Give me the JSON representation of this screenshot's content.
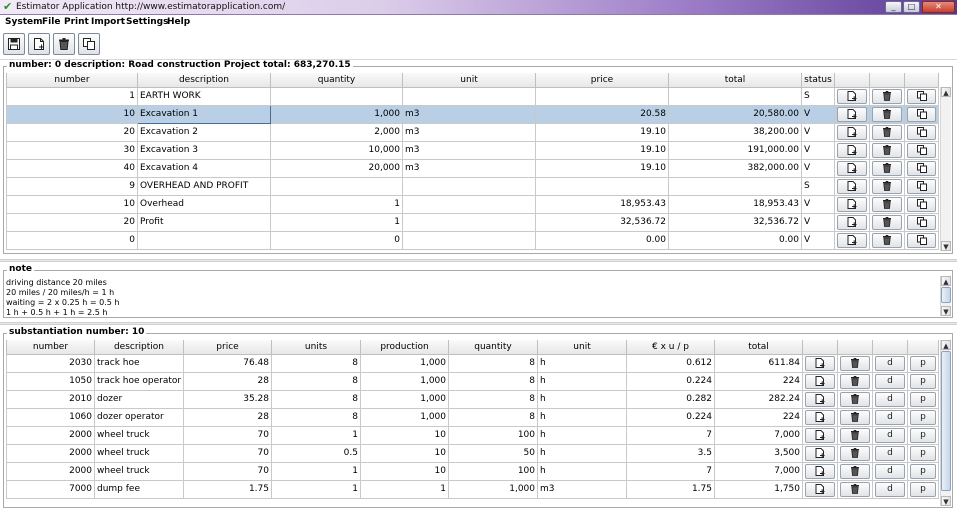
{
  "window": {
    "title": "Estimator Application http://www.estimatorapplication.com/",
    "minimize": "_",
    "maximize": "□",
    "close": "✕"
  },
  "menu": [
    "System",
    "File",
    "Print",
    "Import",
    "Settings",
    "Help"
  ],
  "toolbar": {
    "save_icon": "floppy-disk",
    "new_icon": "new-document",
    "delete_icon": "trash",
    "copy_icon": "copy-documents"
  },
  "project": {
    "title": "number: 0 description: Road construction Project total: 683,270.15",
    "columns": [
      "number",
      "description",
      "quantity",
      "unit",
      "price",
      "total",
      "status",
      "",
      "",
      ""
    ],
    "rows": [
      {
        "number": "1",
        "description": "EARTH WORK",
        "quantity": "",
        "unit": "",
        "price": "",
        "total": "",
        "status": "S"
      },
      {
        "number": "10",
        "description": "Excavation 1",
        "quantity": "1,000",
        "unit": "m3",
        "price": "20.58",
        "total": "20,580.00",
        "status": "V"
      },
      {
        "number": "20",
        "description": "Excavation 2",
        "quantity": "2,000",
        "unit": "m3",
        "price": "19.10",
        "total": "38,200.00",
        "status": "V"
      },
      {
        "number": "30",
        "description": "Excavation 3",
        "quantity": "10,000",
        "unit": "m3",
        "price": "19.10",
        "total": "191,000.00",
        "status": "V"
      },
      {
        "number": "40",
        "description": "Excavation 4",
        "quantity": "20,000",
        "unit": "m3",
        "price": "19.10",
        "total": "382,000.00",
        "status": "V"
      },
      {
        "number": "9",
        "description": "OVERHEAD AND PROFIT",
        "quantity": "",
        "unit": "",
        "price": "",
        "total": "",
        "status": "S"
      },
      {
        "number": "10",
        "description": "Overhead",
        "quantity": "1",
        "unit": "",
        "price": "18,953.43",
        "total": "18,953.43",
        "status": "V"
      },
      {
        "number": "20",
        "description": "Profit",
        "quantity": "1",
        "unit": "",
        "price": "32,536.72",
        "total": "32,536.72",
        "status": "V"
      },
      {
        "number": "0",
        "description": "",
        "quantity": "0",
        "unit": "",
        "price": "0.00",
        "total": "0.00",
        "status": "V"
      }
    ]
  },
  "note": {
    "title": "note",
    "text": "driving distance 20 miles\n20 miles / 20 miles/h = 1 h\nwaiting = 2 x 0.25 h = 0.5 h\n1 h + 0.5 h + 1 h = 2.5 h"
  },
  "substantiation": {
    "title": "substantiation number: 10",
    "columns": [
      "number",
      "description",
      "price",
      "units",
      "production",
      "quantity",
      "unit",
      "€ x u / p",
      "total",
      "",
      "",
      "",
      ""
    ],
    "rows": [
      {
        "number": "2030",
        "description": "track hoe",
        "price": "76.48",
        "units": "8",
        "production": "1,000",
        "quantity": "8",
        "unit": "h",
        "eup": "0.612",
        "total": "611.84"
      },
      {
        "number": "1050",
        "description": "track hoe operator",
        "price": "28",
        "units": "8",
        "production": "1,000",
        "quantity": "8",
        "unit": "h",
        "eup": "0.224",
        "total": "224"
      },
      {
        "number": "2010",
        "description": "dozer",
        "price": "35.28",
        "units": "8",
        "production": "1,000",
        "quantity": "8",
        "unit": "h",
        "eup": "0.282",
        "total": "282.24"
      },
      {
        "number": "1060",
        "description": "dozer operator",
        "price": "28",
        "units": "8",
        "production": "1,000",
        "quantity": "8",
        "unit": "h",
        "eup": "0.224",
        "total": "224"
      },
      {
        "number": "2000",
        "description": "wheel truck",
        "price": "70",
        "units": "1",
        "production": "10",
        "quantity": "100",
        "unit": "h",
        "eup": "7",
        "total": "7,000"
      },
      {
        "number": "2000",
        "description": "wheel truck",
        "price": "70",
        "units": "0.5",
        "production": "10",
        "quantity": "50",
        "unit": "h",
        "eup": "3.5",
        "total": "3,500"
      },
      {
        "number": "2000",
        "description": "wheel truck",
        "price": "70",
        "units": "1",
        "production": "10",
        "quantity": "100",
        "unit": "h",
        "eup": "7",
        "total": "7,000"
      },
      {
        "number": "7000",
        "description": "dump fee",
        "price": "1.75",
        "units": "1",
        "production": "1",
        "quantity": "1,000",
        "unit": "m3",
        "eup": "1.75",
        "total": "1,750"
      }
    ],
    "d_label": "d",
    "p_label": "p"
  }
}
